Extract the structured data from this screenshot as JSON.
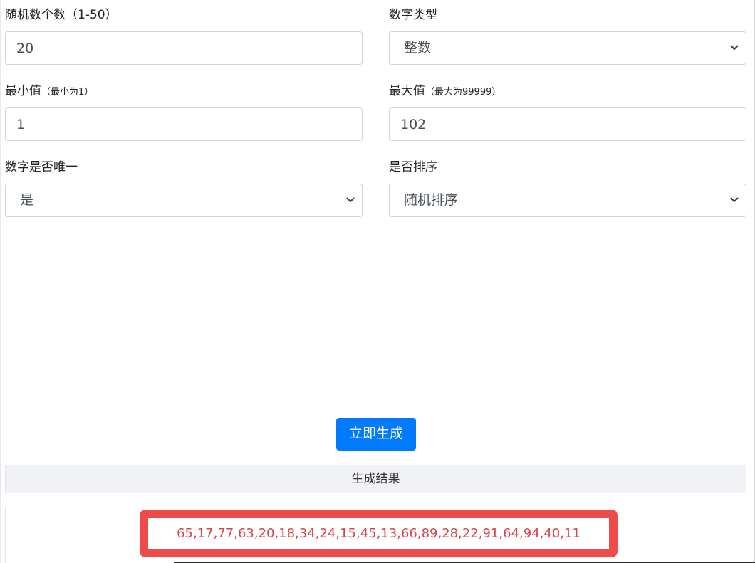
{
  "form": {
    "count": {
      "label": "随机数个数（1-50）",
      "value": "20"
    },
    "type": {
      "label": "数字类型",
      "selected": "整数"
    },
    "min": {
      "label": "最小值",
      "hint": "（最小为1）",
      "value": "1"
    },
    "max": {
      "label": "最大值",
      "hint": "（最大为99999）",
      "value": "102"
    },
    "unique": {
      "label": "数字是否唯一",
      "selected": "是"
    },
    "sort": {
      "label": "是否排序",
      "selected": "随机排序"
    }
  },
  "generate_button": "立即生成",
  "result": {
    "header": "生成结果",
    "numbers": "65,17,77,63,20,18,34,24,15,45,13,66,89,28,22,91,64,94,40,11"
  },
  "icons": {
    "dropdown": "chevron-down-icon"
  },
  "colors": {
    "primary": "#007bff",
    "result_text": "#d9464a",
    "highlight_border": "#f04b4b"
  }
}
